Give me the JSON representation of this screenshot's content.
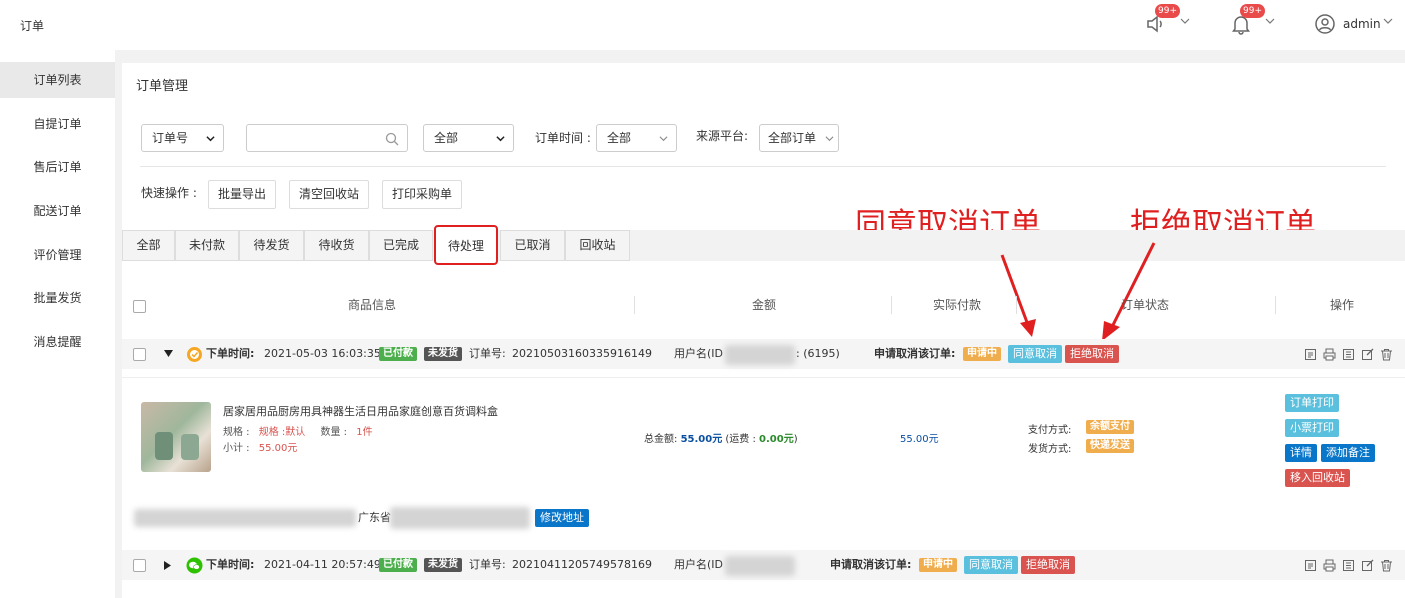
{
  "topbar": {
    "title": "订单",
    "notice_badge": "99+",
    "bell_badge": "99+",
    "user_name": "admin"
  },
  "sidebar": {
    "items": [
      {
        "label": "订单列表",
        "active": true
      },
      {
        "label": "自提订单"
      },
      {
        "label": "售后订单"
      },
      {
        "label": "配送订单"
      },
      {
        "label": "评价管理"
      },
      {
        "label": "批量发货"
      },
      {
        "label": "消息提醒"
      }
    ]
  },
  "main": {
    "title": "订单管理",
    "filters": {
      "search_type": "订单号",
      "search_value": "",
      "status_select": "全部",
      "order_time_label": "订单时间 :",
      "order_time_value": "全部",
      "platform_label": "来源平台:",
      "platform_value": "全部订单"
    },
    "quick_label": "快速操作 :",
    "quick_buttons": [
      "批量导出",
      "清空回收站",
      "打印采购单"
    ],
    "tabs": [
      "全部",
      "未付款",
      "待发货",
      "待收货",
      "已完成",
      "待处理",
      "已取消",
      "回收站"
    ],
    "active_tab": "待处理",
    "annotations": {
      "agree": "同意取消订单",
      "reject": "拒绝取消订单"
    },
    "table_headers": [
      "商品信息",
      "金额",
      "实际付款",
      "订单状态",
      "操作"
    ]
  },
  "orders": [
    {
      "time_label": "下单时间:",
      "time": "2021-05-03 16:03:35",
      "pay_tag": "已付款",
      "ship_tag": "未发货",
      "order_no_label": "订单号:",
      "order_no": "20210503160335916149",
      "user_label": "用户名(ID",
      "user_tail": ": (6195)",
      "cancel_label": "申请取消该订单:",
      "cancel_status": "申请中",
      "agree_btn": "同意取消",
      "reject_btn": "拒绝取消",
      "product_name": "居家居用品厨房用具神器生活日用品家庭创意百货调料盒",
      "spec_label": "规格 :",
      "spec_value": "规格 :默认",
      "qty_label": "数量 :",
      "qty_value": "1件",
      "subtotal_label": "小计 :",
      "subtotal_value": "55.00元",
      "total_label": "总金额:",
      "total_value": "55.00元",
      "freight_label": "(运费 :",
      "freight_value": "0.00元",
      "freight_close": ")",
      "paid_value": "55.00元",
      "pay_method_label": "支付方式:",
      "pay_method": "余额支付",
      "ship_method_label": "发货方式:",
      "ship_method": "快递发送",
      "actions": [
        "订单打印",
        "小票打印",
        "详情",
        "添加备注",
        "移入回收站"
      ],
      "address_prefix": "广东省",
      "address_btn": "修改地址"
    },
    {
      "time_label": "下单时间:",
      "time": "2021-04-11 20:57:49",
      "pay_tag": "已付款",
      "ship_tag": "未发货",
      "order_no_label": "订单号:",
      "order_no": "20210411205749578169",
      "user_label": "用户名(ID",
      "cancel_label": "申请取消该订单:",
      "cancel_status": "申请中",
      "agree_btn": "同意取消",
      "reject_btn": "拒绝取消"
    }
  ],
  "colors": {
    "tag_green": "#4cae4c",
    "tag_dark": "#555555",
    "tag_orange": "#f0ad4e",
    "btn_cyan": "#5bc0de",
    "btn_red": "#d9534f",
    "btn_blue": "#0a76c9",
    "annotation_red": "#e02020"
  }
}
